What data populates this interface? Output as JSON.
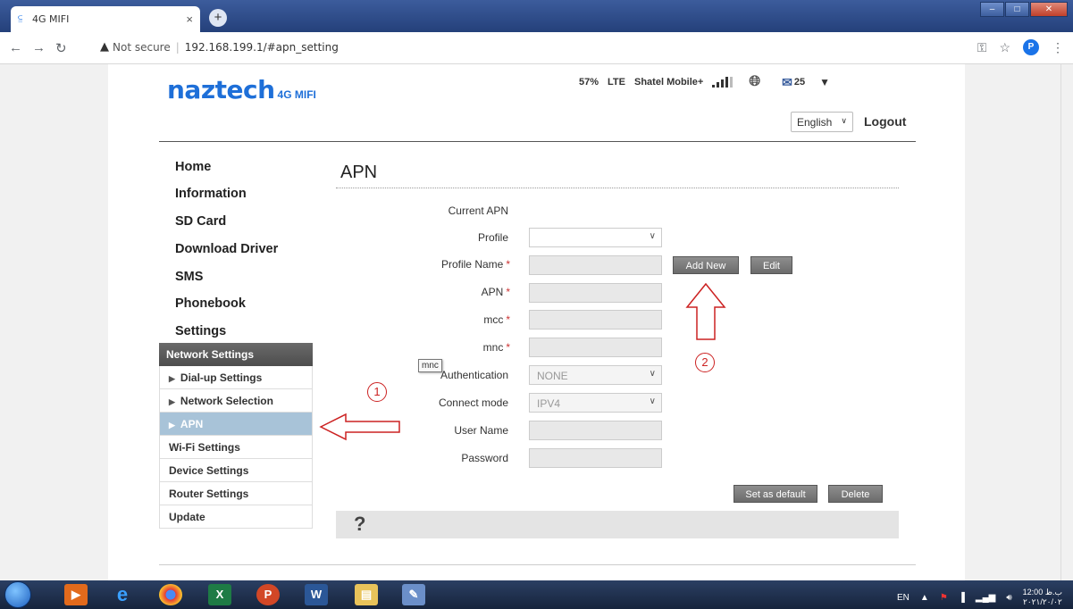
{
  "browser": {
    "tab_title": "4G MIFI",
    "new_tab": "+",
    "close_tab": "×",
    "security_label": "Not secure",
    "url": "192.168.199.1/#apn_setting",
    "profile_initial": "P"
  },
  "header": {
    "logo_main": "naztech",
    "logo_sub": "4G MIFI",
    "battery": "57%",
    "network_type": "LTE",
    "operator": "Shatel Mobile+",
    "messages_count": "25",
    "language": "English",
    "logout": "Logout"
  },
  "menu": {
    "items": [
      "Home",
      "Information",
      "SD Card",
      "Download Driver",
      "SMS",
      "Phonebook",
      "Settings"
    ],
    "submenu_header": "Network Settings",
    "subitems": [
      "Dial-up Settings",
      "Network Selection",
      "APN"
    ],
    "plain_items": [
      "Wi-Fi Settings",
      "Device Settings",
      "Router Settings",
      "Update"
    ]
  },
  "content": {
    "title": "APN",
    "labels": {
      "current_apn": "Current APN",
      "profile": "Profile",
      "profile_name": "Profile Name",
      "apn": "APN",
      "mcc": "mcc",
      "mnc": "mnc",
      "authentication": "Authentication",
      "connect_mode": "Connect mode",
      "user_name": "User Name",
      "password": "Password"
    },
    "required_mark": "*",
    "authentication_value": "NONE",
    "connect_mode_value": "IPV4",
    "profile_value": "",
    "buttons": {
      "add_new": "Add New",
      "edit": "Edit",
      "set_default": "Set as default",
      "delete": "Delete"
    },
    "tooltip": "mnc",
    "help": "?"
  },
  "annotations": {
    "circle_1": "1",
    "circle_2": "2",
    "color": "#cc2222"
  },
  "taskbar": {
    "lang": "EN",
    "time": "12:00 ب.ظ",
    "date": "۲۰۲۱/۲۰/۰۲"
  }
}
